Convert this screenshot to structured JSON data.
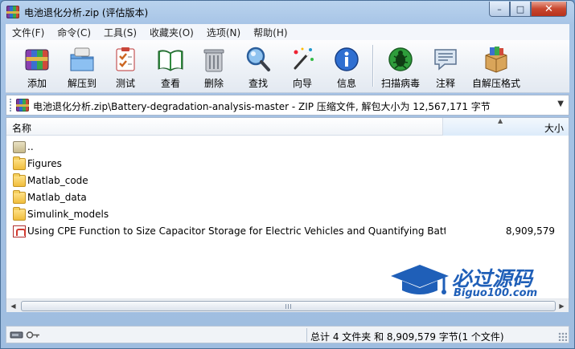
{
  "window": {
    "title": "电池退化分析.zip (评估版本)",
    "controls": {
      "minimize": "–",
      "maximize": "□",
      "close": "✕"
    }
  },
  "menu": [
    "文件(F)",
    "命令(C)",
    "工具(S)",
    "收藏夹(O)",
    "选项(N)",
    "帮助(H)"
  ],
  "toolbar": [
    {
      "label": "添加",
      "icon": "add-archive-icon"
    },
    {
      "label": "解压到",
      "icon": "extract-to-icon"
    },
    {
      "label": "测试",
      "icon": "test-icon"
    },
    {
      "label": "查看",
      "icon": "view-icon"
    },
    {
      "label": "删除",
      "icon": "delete-icon"
    },
    {
      "label": "查找",
      "icon": "find-icon"
    },
    {
      "label": "向导",
      "icon": "wizard-icon"
    },
    {
      "label": "信息",
      "icon": "info-icon"
    },
    {
      "label": "扫描病毒",
      "icon": "virus-scan-icon"
    },
    {
      "label": "注释",
      "icon": "comment-icon"
    },
    {
      "label": "自解压格式",
      "icon": "sfx-icon"
    }
  ],
  "address": {
    "path": "电池退化分析.zip\\Battery-degradation-analysis-master - ZIP 压缩文件, 解包大小为 12,567,171 字节"
  },
  "columns": {
    "name": "名称",
    "size": "大小"
  },
  "files": [
    {
      "name": "..",
      "size": "",
      "type": "updir"
    },
    {
      "name": "Figures",
      "size": "",
      "type": "folder"
    },
    {
      "name": "Matlab_code",
      "size": "",
      "type": "folder"
    },
    {
      "name": "Matlab_data",
      "size": "",
      "type": "folder"
    },
    {
      "name": "Simulink_models",
      "size": "",
      "type": "folder"
    },
    {
      "name": "Using CPE Function to Size Capacitor Storage for Electric Vehicles and Quantifying Batt...",
      "size": "8,909,579",
      "type": "pdf"
    }
  ],
  "watermark": {
    "title": "必过源码",
    "subtitle": "Biguo100.com"
  },
  "status": {
    "summary": "总计 4 文件夹 和 8,909,579 字节(1 个文件)"
  },
  "colors": {
    "accent": "#1f5fb8",
    "chrome": "#a7c4e6"
  }
}
